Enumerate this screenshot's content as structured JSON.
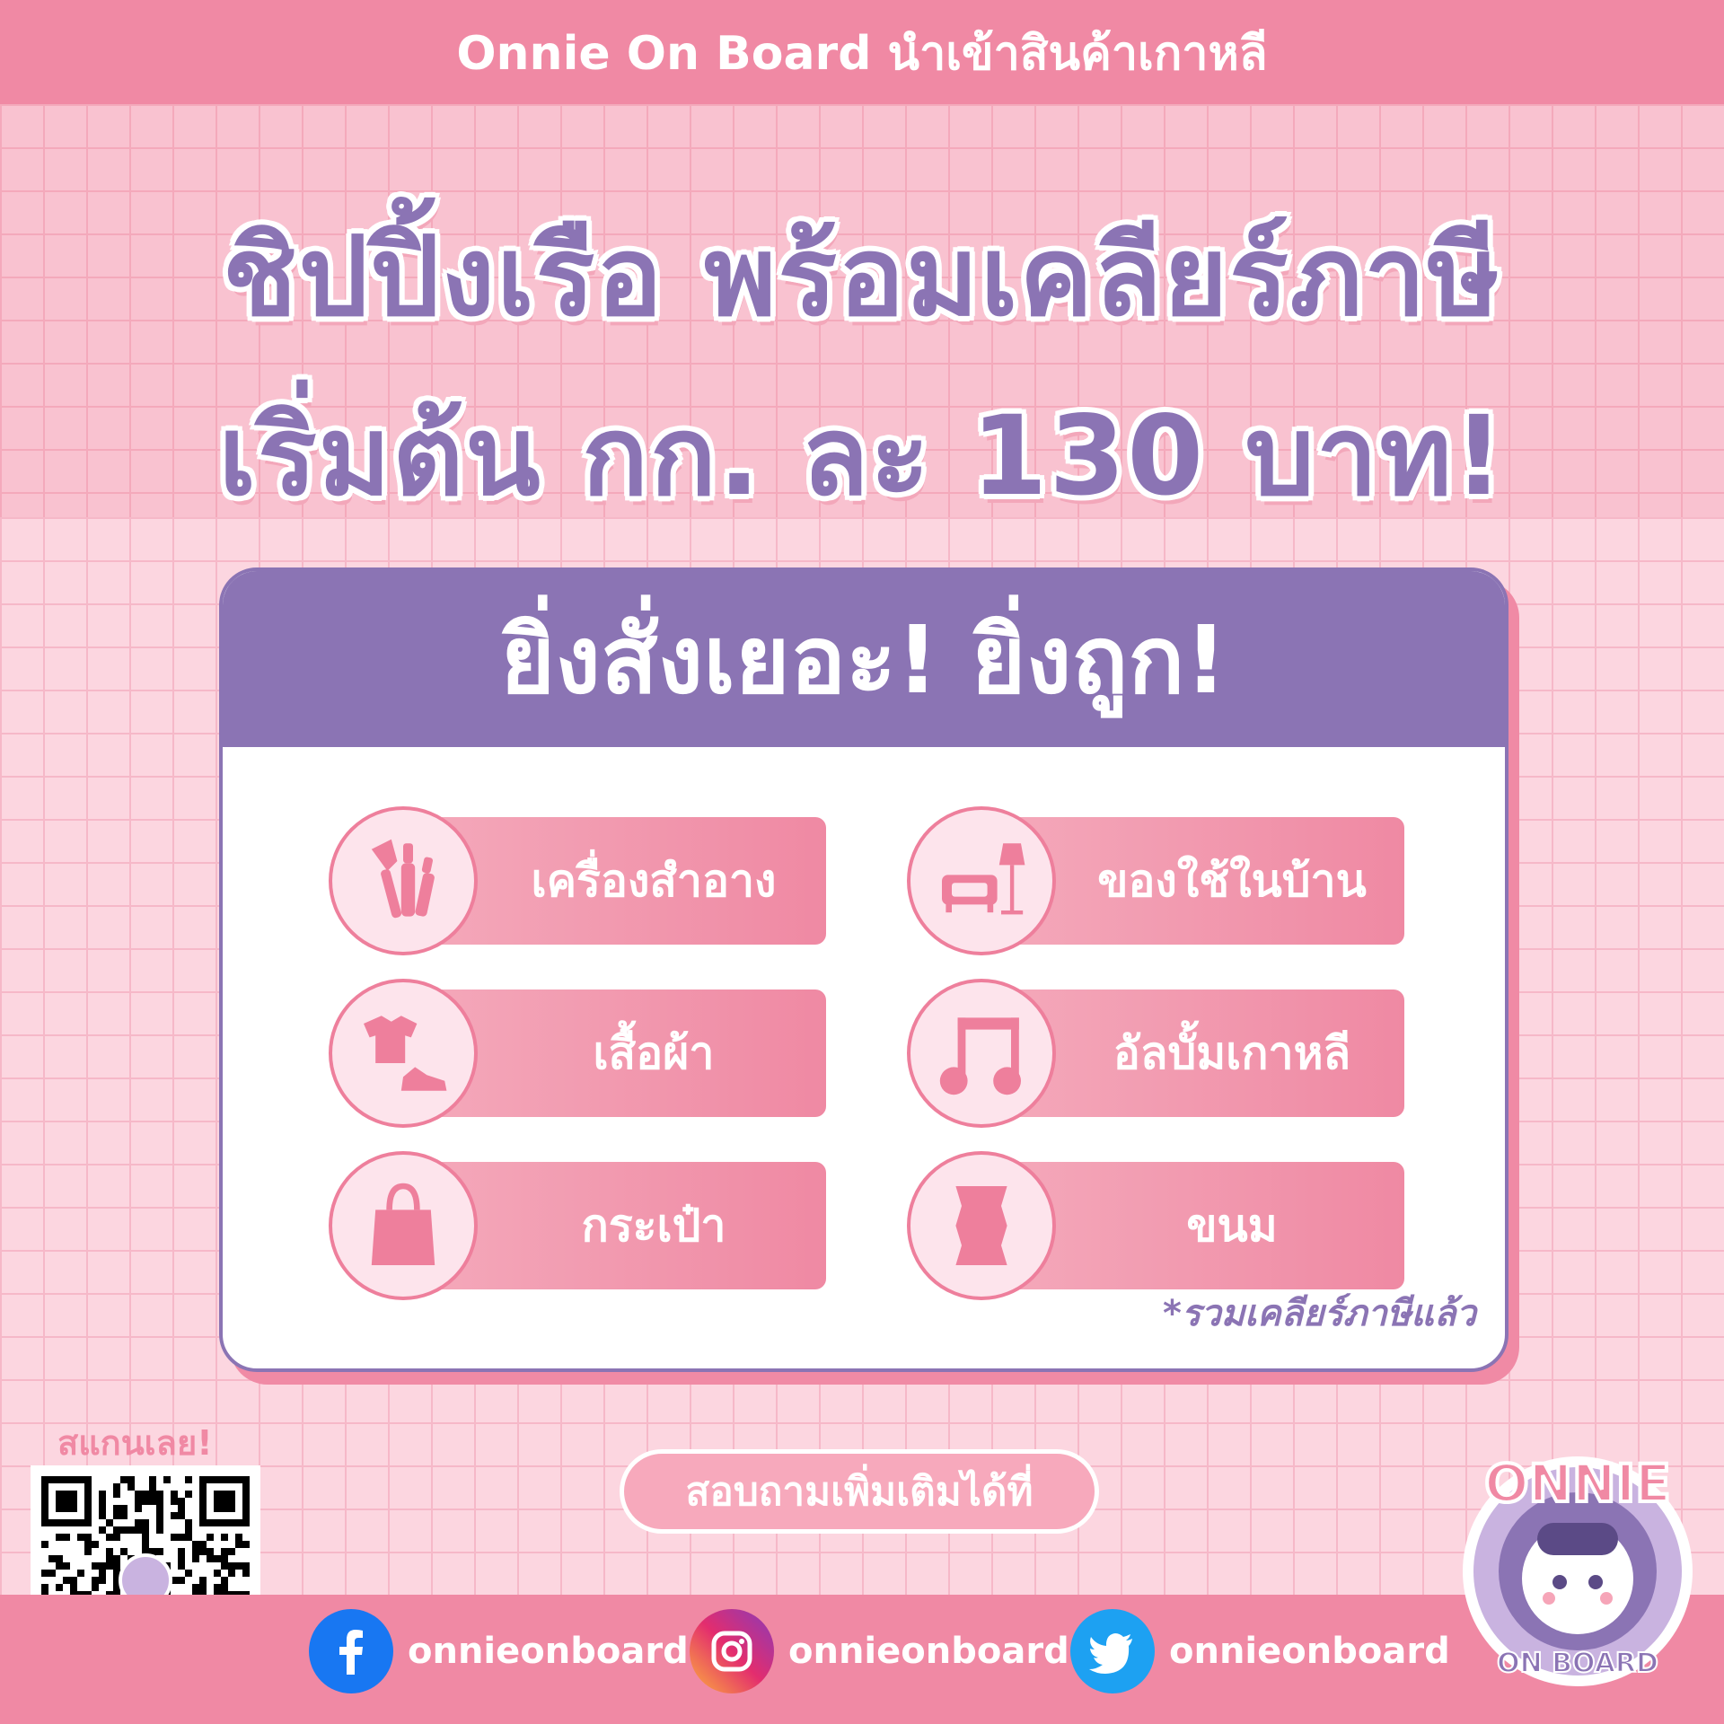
{
  "header": {
    "title": "Onnie On Board นำเข้าสินค้าเกาหลี"
  },
  "headline": {
    "line1": "ชิปปิ้งเรือ พร้อมเคลียร์ภาษี",
    "line2": "เริ่มต้น กก. ละ 130 บาท!"
  },
  "card": {
    "title": "ยิ่งสั่งเยอะ! ยิ่งถูก!",
    "items": [
      {
        "label": "เครื่องสำอาง",
        "icon": "makeup-brush-icon"
      },
      {
        "label": "ของใช้ในบ้าน",
        "icon": "sofa-lamp-icon"
      },
      {
        "label": "เสื้อผ้า",
        "icon": "clothes-shoe-icon"
      },
      {
        "label": "อัลบั้มเกาหลี",
        "icon": "music-note-icon"
      },
      {
        "label": "กระเป๋า",
        "icon": "bag-icon"
      },
      {
        "label": "ขนม",
        "icon": "snack-icon"
      }
    ],
    "note": "*รวมเคลียร์ภาษีแล้ว"
  },
  "scan_label": "สแกนเลย!",
  "inquire_label": "สอบถามเพิ่มเติมได้ที่",
  "social": [
    {
      "platform": "facebook",
      "handle": "onnieonboard",
      "color": "#1877f2"
    },
    {
      "platform": "instagram",
      "handle": "onnieonboard",
      "color": "#d6249f"
    },
    {
      "platform": "twitter",
      "handle": "onnieonboard",
      "color": "#1da1f2"
    }
  ],
  "logo": {
    "top_text": "ONNIE",
    "bottom_text": "ON BOARD"
  },
  "colors": {
    "pink": "#f089a4",
    "purple": "#8b74b4",
    "light_pink": "#fcd6e0"
  }
}
